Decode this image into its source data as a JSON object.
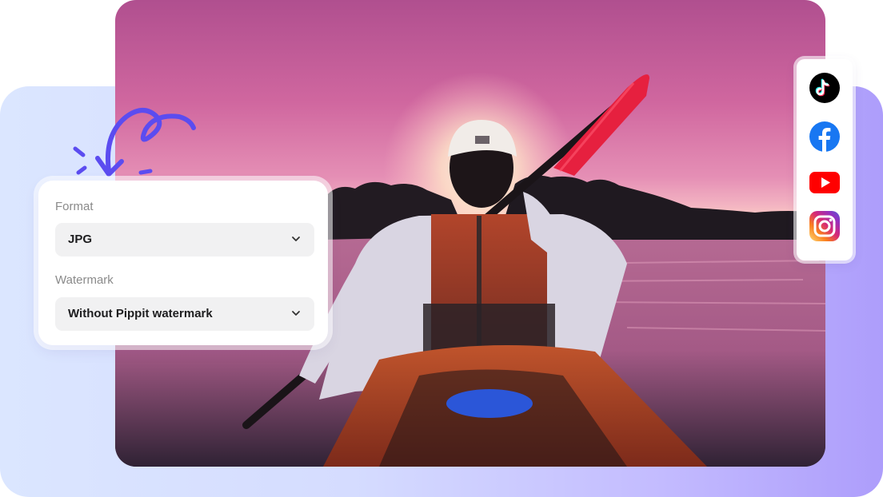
{
  "export_panel": {
    "format_label": "Format",
    "format_value": "JPG",
    "watermark_label": "Watermark",
    "watermark_value": "Without Pippit watermark"
  },
  "social_icons": [
    "tiktok-icon",
    "facebook-icon",
    "youtube-icon",
    "instagram-icon"
  ],
  "colors": {
    "accent_purple": "#5b4cf0",
    "tiktok": "#000000",
    "facebook": "#1877f2",
    "youtube": "#ff0000",
    "instagram_gradient": [
      "#feda75",
      "#fa7e1e",
      "#d62976",
      "#962fbf",
      "#4f5bd5"
    ]
  }
}
